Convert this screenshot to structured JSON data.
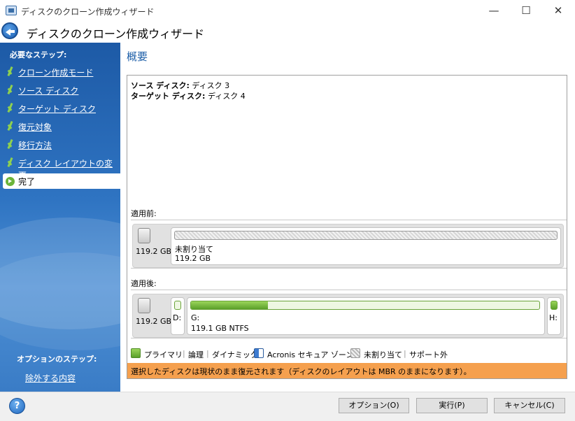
{
  "window": {
    "title": "ディスクのクローン作成ウィザード",
    "minimize": "—",
    "maximize": "☐",
    "close": "✕"
  },
  "header": {
    "title": "ディスクのクローン作成ウィザード"
  },
  "sidebar": {
    "required_label": "必要なステップ:",
    "steps": [
      {
        "label": "クローン作成モード",
        "state": "done"
      },
      {
        "label": "ソース ディスク",
        "state": "done"
      },
      {
        "label": "ターゲット ディスク",
        "state": "done"
      },
      {
        "label": "復元対象",
        "state": "done"
      },
      {
        "label": "移行方法",
        "state": "done"
      },
      {
        "label": "ディスク レイアウトの変更",
        "state": "done"
      },
      {
        "label": "完了",
        "state": "current"
      }
    ],
    "optional_label": "オプションのステップ:",
    "optional_link": "除外する内容"
  },
  "main": {
    "heading": "概要",
    "source": {
      "key": "ソース ディスク:",
      "value": "ディスク 3"
    },
    "target": {
      "key": "ターゲット ディスク:",
      "value": "ディスク 4"
    },
    "before": {
      "label": "適用前:",
      "disk_size": "119.2 GB",
      "partition_title": "未割り当て",
      "partition_size": "119.2 GB"
    },
    "after": {
      "label": "適用後:",
      "disk_size": "119.2 GB",
      "d_label": "D:",
      "g_label": "G:",
      "g_info": "119.1 GB  NTFS",
      "g_used_fraction": 0.22,
      "h_label": "H:"
    },
    "legend": {
      "primary": "プライマリ",
      "logical": "論理",
      "dynamic": "ダイナミック",
      "acronis": "Acronis セキュア ゾーン",
      "unallocated": "未割り当て",
      "unsupported": "サポート外",
      "separator": "|"
    },
    "notice": "選択したディスクは現状のまま復元されます（ディスクのレイアウトは MBR のままになります）。",
    "colors": {
      "notice_bg": "#f5a04e",
      "accent": "#1c5ea8",
      "primary_green": "#5aa02a"
    }
  },
  "footer": {
    "help": "?",
    "options_button": "オプション(O)",
    "run_button": "実行(P)",
    "cancel_button": "キャンセル(C)"
  }
}
